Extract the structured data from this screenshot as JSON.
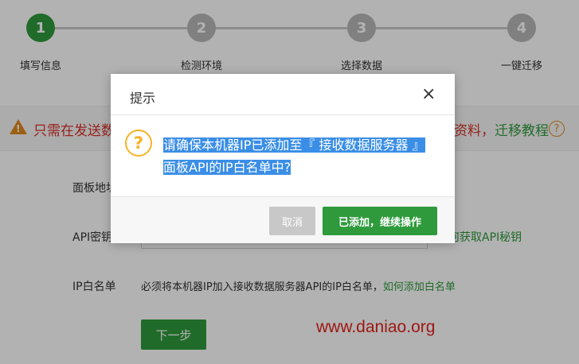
{
  "steps": [
    {
      "number": "1",
      "label": "填写信息",
      "active": true
    },
    {
      "number": "2",
      "label": "检测环境",
      "active": false
    },
    {
      "number": "3",
      "label": "选择数据",
      "active": false
    },
    {
      "number": "4",
      "label": "一键迁移",
      "active": false
    }
  ],
  "notice": {
    "left_text": "只需在发送数",
    "right_text_red": "资料，",
    "right_link": "迁移教程",
    "help_icon": "?"
  },
  "form": {
    "panel_address_label": "面板地址",
    "api_key_label": "API密钥",
    "api_key_link": "何获取API秘钥",
    "ip_whitelist_label": "IP白名单",
    "ip_whitelist_note": "必须将本机器IP加入接收数据服务器API的IP白名单，",
    "ip_whitelist_link": "如何添加白名单",
    "next_button": "下一步"
  },
  "watermark": "www.daniao.org",
  "dialog": {
    "title": "提示",
    "close_icon": "×",
    "icon": "?",
    "message": "请确保本机器IP已添加至『 接收数据服务器 』面板API的IP白名单中?",
    "cancel_button": "取消",
    "confirm_button": "已添加，继续操作"
  },
  "colors": {
    "primary_green": "#2e9a3c",
    "warning_red": "#d9312a",
    "warning_orange": "#e08a1e",
    "selection_blue": "#3a8ee6",
    "question_yellow": "#f5b324"
  }
}
